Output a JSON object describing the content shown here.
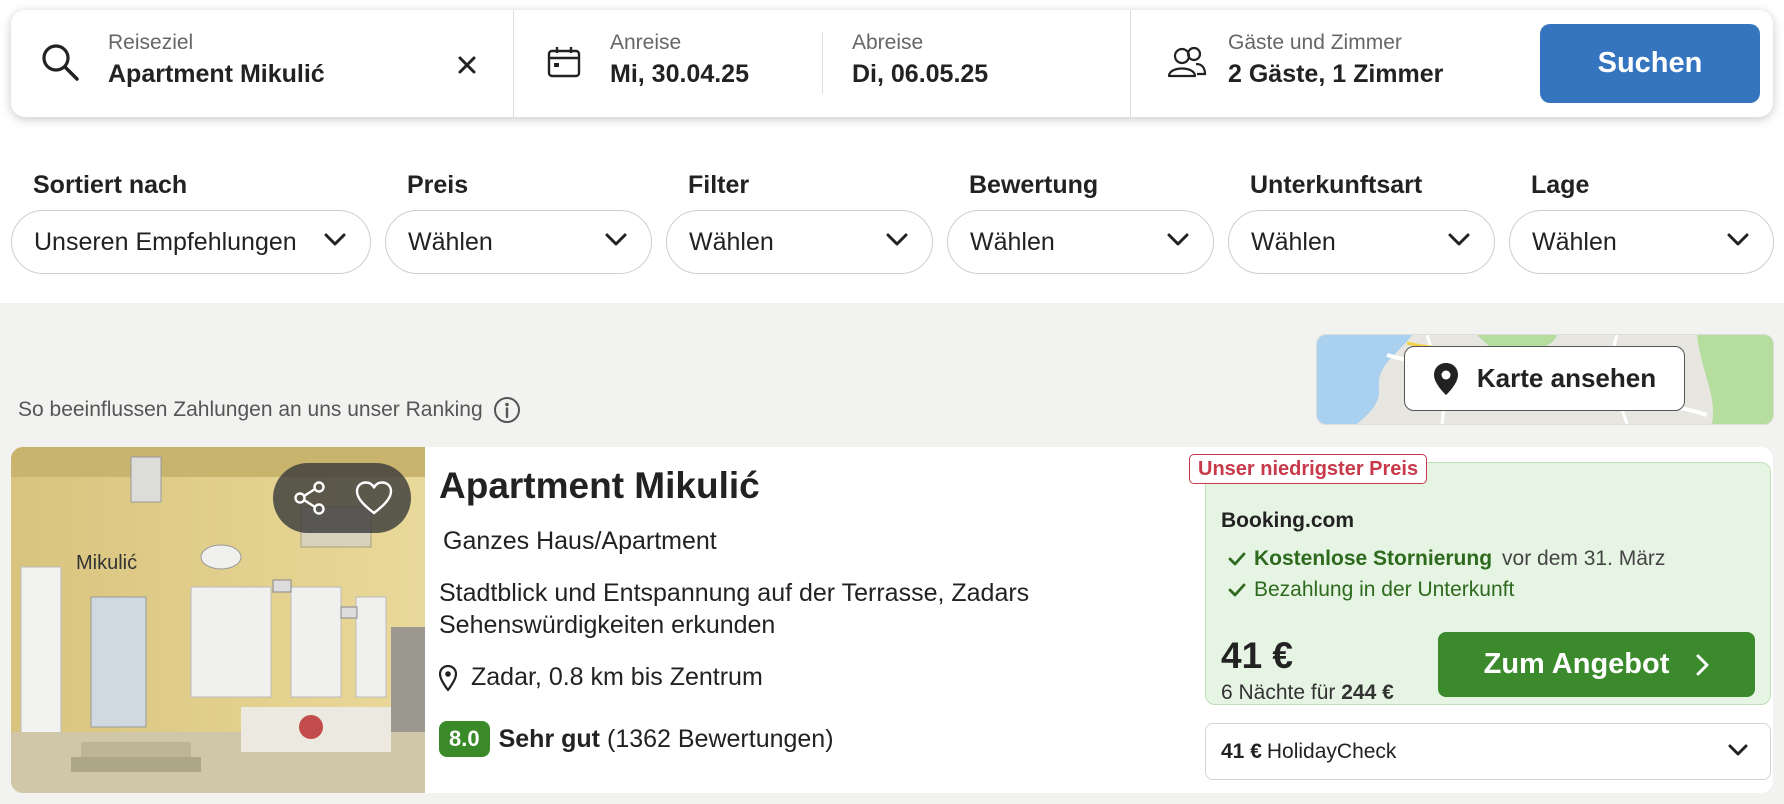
{
  "search": {
    "destination_label": "Reiseziel",
    "destination_value": "Apartment Mikulić",
    "checkin_label": "Anreise",
    "checkin_value": "Mi, 30.04.25",
    "checkout_label": "Abreise",
    "checkout_value": "Di, 06.05.25",
    "guests_label": "Gäste und Zimmer",
    "guests_value": "2 Gäste, 1 Zimmer",
    "search_button": "Suchen",
    "accent_color": "#3575c0"
  },
  "filters": [
    {
      "title": "Sortiert nach",
      "value": "Unseren Empfehlungen"
    },
    {
      "title": "Preis",
      "value": "Wählen"
    },
    {
      "title": "Filter",
      "value": "Wählen"
    },
    {
      "title": "Bewertung",
      "value": "Wählen"
    },
    {
      "title": "Unterkunftsart",
      "value": "Wählen"
    },
    {
      "title": "Lage",
      "value": "Wählen"
    }
  ],
  "ranking_info": "So beeinflussen Zahlungen an uns unser Ranking",
  "map_button": "Karte ansehen",
  "result": {
    "image_sign_text": "Mikulić",
    "name": "Apartment Mikulić",
    "type": "Ganzes Haus/Apartment",
    "description": "Stadtblick und Entspannung auf der Terrasse, Zadars Sehenswürdigkeiten erkunden",
    "location": "Zadar, 0.8 km bis Zentrum",
    "rating_score": "8.0",
    "rating_label": "Sehr gut",
    "rating_count": "(1362 Bewertungen)",
    "deal": {
      "badge": "Unser niedrigster Preis",
      "provider": "Booking.com",
      "perk1_bold": "Kostenlose Stornierung",
      "perk1_rest": "vor dem 31. März",
      "perk2": "Bezahlung in der Unterkunft",
      "price": "41 €",
      "nights_text": "6 Nächte für",
      "total_price": "244 €",
      "button": "Zum Angebot",
      "button_color": "#3b8a2b",
      "badge_color": "#c8394a"
    },
    "alt_offer": {
      "price": "41 €",
      "provider": "HolidayCheck"
    }
  }
}
